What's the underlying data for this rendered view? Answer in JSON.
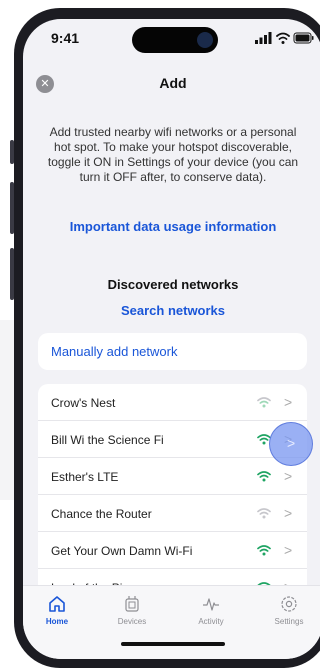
{
  "status_bar": {
    "time": "9:41"
  },
  "header": {
    "title": "Add",
    "close_icon": "close-icon"
  },
  "intro": {
    "text": "Add trusted nearby wifi networks or a personal hot spot. To make your hotspot discoverable, toggle it ON in Settings of your device (you can turn it OFF after, to conserve data).",
    "link": "Important data usage information"
  },
  "discovered": {
    "heading": "Discovered networks",
    "search_link": "Search networks"
  },
  "manual": {
    "label": "Manually add network"
  },
  "networks": [
    {
      "name": "Crow's Nest",
      "signal": 2
    },
    {
      "name": "Bill Wi the Science Fi",
      "signal": 3
    },
    {
      "name": "Esther's LTE",
      "signal": 3
    },
    {
      "name": "Chance the Router",
      "signal": 1
    },
    {
      "name": "Get Your Own Damn Wi-Fi",
      "signal": 3
    },
    {
      "name": "Lord of the Ping",
      "signal": 3
    }
  ],
  "tabs": [
    {
      "label": "Home",
      "icon": "home-icon",
      "active": true
    },
    {
      "label": "Devices",
      "icon": "devices-icon",
      "active": false
    },
    {
      "label": "Activity",
      "icon": "activity-icon",
      "active": false
    },
    {
      "label": "Settings",
      "icon": "gear-icon",
      "active": false
    }
  ],
  "colors": {
    "accent": "#1a56d8",
    "wifi_strong": "#1fa463",
    "wifi_weak": "#9fd9b8",
    "wifi_faint": "#c7c7cc"
  }
}
